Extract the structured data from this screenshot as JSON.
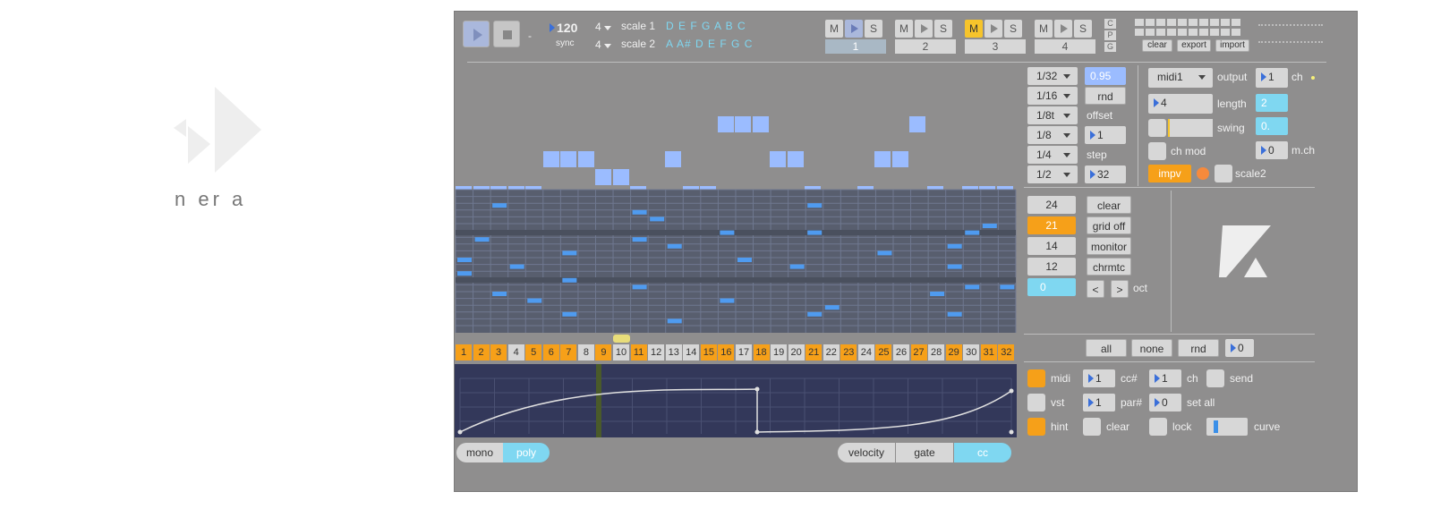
{
  "brand": {
    "text": "n er a"
  },
  "transport": {
    "tempo": "120",
    "sync_label": "sync",
    "dash": "-",
    "meter1": "4",
    "meter2": "4",
    "scale1_label": "scale 1",
    "scale2_label": "scale 2",
    "scale1_notes": "D E F G A B C",
    "scale2_notes": "A A# D E F G C"
  },
  "tracks": [
    {
      "m": "M",
      "s": "S",
      "num": "1",
      "mute_on": false,
      "selected": true
    },
    {
      "m": "M",
      "s": "S",
      "num": "2",
      "mute_on": false,
      "selected": false
    },
    {
      "m": "M",
      "s": "S",
      "num": "3",
      "mute_on": true,
      "selected": false
    },
    {
      "m": "M",
      "s": "S",
      "num": "4",
      "mute_on": false,
      "selected": false
    }
  ],
  "cpg": [
    "C",
    "P",
    "G"
  ],
  "patterns": {
    "clear": "clear",
    "export": "export",
    "import": "import"
  },
  "divisions": [
    "1/32",
    "1/16",
    "1/8t",
    "1/8",
    "1/4",
    "1/2"
  ],
  "timing": {
    "prob": "0.95",
    "rnd": "rnd",
    "offset_label": "offset",
    "offset": "1",
    "step_label": "step",
    "step": "32"
  },
  "output": {
    "device": "midi1",
    "output_label": "output",
    "ch": "1",
    "ch_label": "ch",
    "length": "4",
    "length_label": "length",
    "length_val": "2",
    "swing_label": "swing",
    "swing_val": "0.",
    "chmod_label": "ch mod",
    "mch": "0",
    "mch_label": "m.ch",
    "impv": "impv",
    "scale2_label": "scale2"
  },
  "rows": {
    "values": [
      "24",
      "21",
      "14",
      "12",
      "0"
    ],
    "highlight_index": 1,
    "cyan_index": 4
  },
  "grid_buttons": [
    "clear",
    "grid off",
    "monitor",
    "chrmtc"
  ],
  "oct": {
    "down": "<",
    "up": ">",
    "label": "oct"
  },
  "steps": [
    "1",
    "2",
    "3",
    "4",
    "5",
    "6",
    "7",
    "8",
    "9",
    "10",
    "11",
    "12",
    "13",
    "14",
    "15",
    "16",
    "17",
    "18",
    "19",
    "20",
    "21",
    "22",
    "23",
    "24",
    "25",
    "26",
    "27",
    "28",
    "29",
    "30",
    "31",
    "32"
  ],
  "active_steps": [
    1,
    2,
    3,
    5,
    6,
    7,
    9,
    11,
    15,
    16,
    18,
    21,
    23,
    25,
    27,
    29,
    31,
    32
  ],
  "current_step": 9,
  "select": {
    "all": "all",
    "none": "none",
    "rnd": "rnd",
    "num": "0"
  },
  "mod": {
    "midi": "midi",
    "cc_label": "cc#",
    "cc": "1",
    "ch_label": "ch",
    "ch": "1",
    "send": "send",
    "vst": "vst",
    "par_label": "par#",
    "par": "1",
    "setall_val": "0",
    "setall": "set all",
    "hint": "hint",
    "clear": "clear",
    "lock": "lock",
    "curve": "curve"
  },
  "voice": {
    "mono": "mono",
    "poly": "poly"
  },
  "lanes": {
    "velocity": "velocity",
    "gate": "gate",
    "cc": "cc"
  },
  "melody": [
    8,
    8,
    8,
    8,
    8,
    6,
    6,
    6,
    7,
    7,
    8,
    9,
    6,
    8,
    8,
    4,
    4,
    4,
    6,
    6,
    8,
    9,
    9,
    8,
    6,
    6,
    4,
    8,
    9,
    8,
    8,
    8
  ]
}
